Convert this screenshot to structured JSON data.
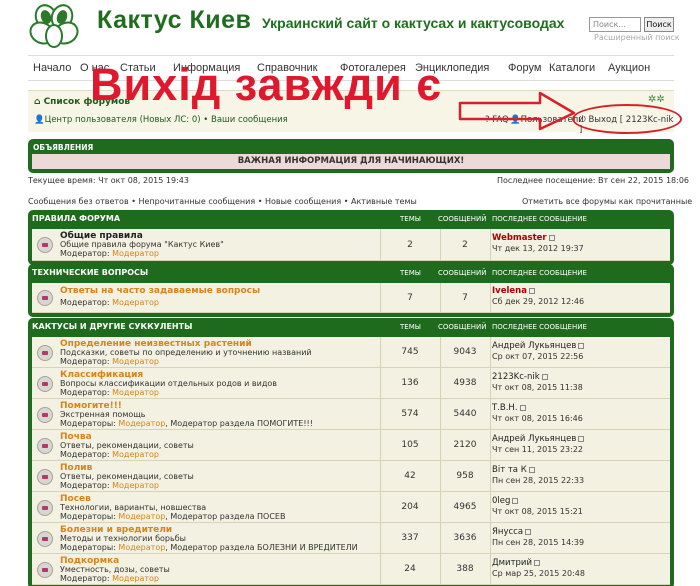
{
  "header": {
    "title": "Кактус Киев",
    "tagline": "Украинский сайт о кактусах и кактусоводах",
    "search_placeholder": "Поиск...",
    "search_button": "Поиск",
    "advanced_search": "Расширенный поиск"
  },
  "nav": [
    "Начало",
    "О нас",
    "Статьи",
    "Информация",
    "Справочник",
    "Фотогалерея",
    "Энциклопедия",
    "Форум",
    "Каталоги",
    "Аукцион"
  ],
  "overlay": {
    "text": "Вихід завжди є",
    "color": "#e0182d"
  },
  "topbar": {
    "forum_list": "Список форумов",
    "ucp": "Центр пользователя (Новых ЛС: 0) • Ваши сообщения",
    "faq": "FAQ",
    "users": "Пользователи",
    "logout": "Выход [ 2123Kc-nik ]"
  },
  "announcements": {
    "header": "ОБЪЯВЛЕНИЯ",
    "body": "ВАЖНАЯ ИНФОРМАЦИЯ ДЛЯ НАЧИНАЮЩИХ!"
  },
  "status": {
    "current_time": "Текущее время: Чт окт 08, 2015 19:43",
    "last_visit": "Последнее посещение: Вт сен 22, 2015 18:06",
    "links": "Сообщения без ответов • Непрочитанные сообщения • Новые сообщения • Активные темы",
    "mark_read": "Отметить все форумы как прочитанные"
  },
  "columns": {
    "topics": "ТЕМЫ",
    "posts": "СООБЩЕНИЙ",
    "last": "ПОСЛЕДНЕЕ СООБЩЕНИЕ"
  },
  "categories": [
    {
      "title": "ПРАВИЛА ФОРУМА",
      "forums": [
        {
          "name": "Общие правила",
          "desc": "Общие правила форума \"Кактус Киев\"",
          "mod_prefix": "Модератор:",
          "mod": "Модератор",
          "mod_extra": "",
          "topics": "2",
          "posts": "2",
          "last_user": "Webmaster",
          "last_date": "Чт дек 13, 2012 19:37"
        }
      ]
    },
    {
      "title": "ТЕХНИЧЕСКИЕ ВОПРОСЫ",
      "forums": [
        {
          "name": "Ответы на часто задаваемые вопросы",
          "desc": "",
          "mod_prefix": "Модератор:",
          "mod": "Модератор",
          "mod_extra": "",
          "topics": "7",
          "posts": "7",
          "last_user": "Ivelena",
          "last_date": "Сб дек 29, 2012 12:46"
        }
      ]
    },
    {
      "title": "КАКТУСЫ И ДРУГИЕ СУККУЛЕНТЫ",
      "forums": [
        {
          "name": "Определение неизвестных растений",
          "desc": "Подсказки, советы по определению и уточнению названий",
          "mod_prefix": "Модератор:",
          "mod": "Модератор",
          "mod_extra": "",
          "topics": "745",
          "posts": "9043",
          "last_user": "Андрей Лукьянцев",
          "last_date": "Ср окт 07, 2015 22:56"
        },
        {
          "name": "Классификация",
          "desc": "Вопросы классификации отдельных родов и видов",
          "mod_prefix": "Модератор:",
          "mod": "Модератор",
          "mod_extra": "",
          "topics": "136",
          "posts": "4938",
          "last_user": "2123Kc-nik",
          "last_date": "Чт окт 08, 2015 11:38"
        },
        {
          "name": "Помогите!!!",
          "desc": "Экстренная помощь",
          "mod_prefix": "Модераторы:",
          "mod": "Модератор",
          "mod_extra": ", Модератор раздела ПОМОГИТЕ!!!",
          "topics": "574",
          "posts": "5440",
          "last_user": "Т.В.Н.",
          "last_date": "Чт окт 08, 2015 16:46"
        },
        {
          "name": "Почва",
          "desc": "Ответы, рекомендации, советы",
          "mod_prefix": "Модератор:",
          "mod": "Модератор",
          "mod_extra": "",
          "topics": "105",
          "posts": "2120",
          "last_user": "Андрей Лукьянцев",
          "last_date": "Чт сен 11, 2015 23:22"
        },
        {
          "name": "Полив",
          "desc": "Ответы, рекомендации, советы",
          "mod_prefix": "Модератор:",
          "mod": "Модератор",
          "mod_extra": "",
          "topics": "42",
          "posts": "958",
          "last_user": "Віт та К",
          "last_date": "Пн сен 28, 2015 22:33"
        },
        {
          "name": "Посев",
          "desc": "Технологии, варианты, новшества",
          "mod_prefix": "Модераторы:",
          "mod": "Модератор",
          "mod_extra": ", Модератор раздела ПОСЕВ",
          "topics": "204",
          "posts": "4965",
          "last_user": "0leg",
          "last_date": "Чт окт 08, 2015 15:21"
        },
        {
          "name": "Болезни и вредители",
          "desc": "Методы и технологии борьбы",
          "mod_prefix": "Модераторы:",
          "mod": "Модератор",
          "mod_extra": ", Модератор раздела БОЛЕЗНИ И ВРЕДИТЕЛИ",
          "topics": "337",
          "posts": "3636",
          "last_user": "Янусса",
          "last_date": "Пн сен 28, 2015 14:39"
        },
        {
          "name": "Подкормка",
          "desc": "Уместность, дозы, советы",
          "mod_prefix": "Модератор:",
          "mod": "Модератор",
          "mod_extra": "",
          "topics": "24",
          "posts": "388",
          "last_user": "Дмитрий",
          "last_date": "Ср мар 25, 2015 20:48"
        }
      ]
    }
  ]
}
